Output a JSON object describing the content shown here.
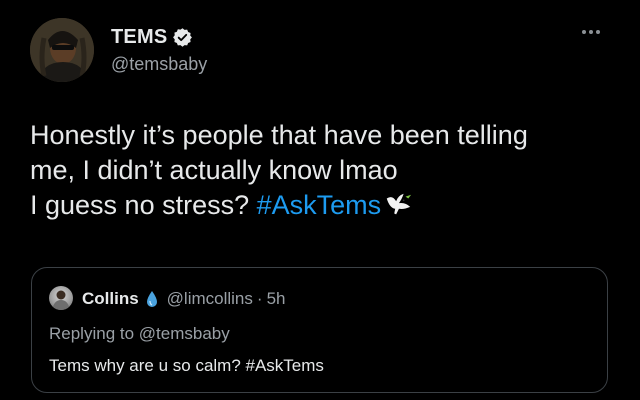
{
  "tweet": {
    "display_name": "TEMS",
    "handle": "@temsbaby",
    "verified": true,
    "lines": [
      "Honestly it’s people that have been telling",
      "me, I didn’t actually know lmao",
      "I guess no stress? "
    ],
    "hashtag": "#AskTems",
    "emoji": "dove-icon"
  },
  "quote": {
    "display_name": "Collins",
    "handle": "@limcollins",
    "separator": "·",
    "time": "5h",
    "replying_to_prefix": "Replying to ",
    "replying_to_handle": "@temsbaby",
    "text": "Tems why are u so calm? #AskTems"
  },
  "colors": {
    "background": "#000000",
    "text": "#e7e9ea",
    "secondary": "#9aa0a6",
    "link": "#1d9bf0",
    "border": "#3b4045"
  }
}
